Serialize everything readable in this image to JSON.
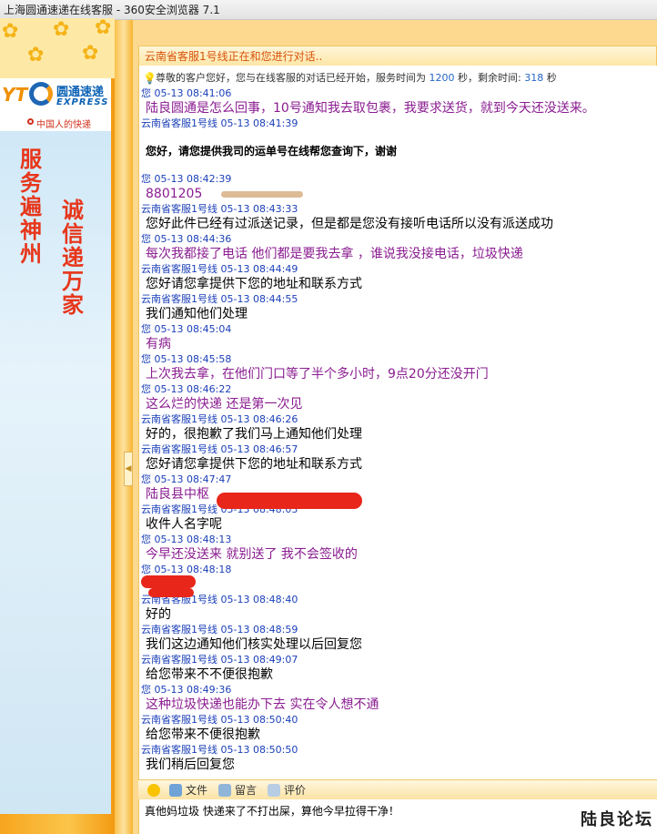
{
  "window_title": "上海圆通速递在线客服 - 360安全浏览器 7.1",
  "brand": {
    "logo_text": "YT",
    "name_cn": "圆通速递",
    "name_en": "EXPRESS",
    "slogan": "中国人的快递",
    "vertical_left": "服务遍神州",
    "vertical_right": "诚信递万家",
    "colors": {
      "orange": "#f7a51e",
      "blue": "#0b62b5",
      "red": "#e7361b"
    }
  },
  "chat_header": "云南省客服1号线正在和您进行对话..",
  "system_notice": {
    "prefix": "尊敬的客户您好，您与在线客服的对话已经开始，服务时间为",
    "service_seconds": "1200",
    "middle": "秒，剩余时间:",
    "remaining_seconds": "318",
    "suffix": "秒"
  },
  "messages": [
    {
      "role": "user",
      "sender": "您",
      "time": "05-13 08:41:06",
      "text": "陆良圆通是怎么回事，10号通知我去取包裹，我要求送货，就到今天还没送来。"
    },
    {
      "role": "agent",
      "sender": "云南省客服1号线",
      "time": "05-13 08:41:39",
      "text": "您好，请您提供我司的运单号在线帮您查询下，谢谢"
    },
    {
      "role": "user",
      "sender": "您",
      "time": "05-13 08:42:39",
      "text": "8801205"
    },
    {
      "role": "agent",
      "sender": "云南省客服1号线",
      "time": "05-13 08:43:33",
      "text": "您好此件已经有过派送记录，但是都是您没有接听电话所以没有派送成功"
    },
    {
      "role": "user",
      "sender": "您",
      "time": "05-13 08:44:36",
      "text": "每次我都接了电话 他们都是要我去拿 ，谁说我没接电话，垃圾快递"
    },
    {
      "role": "agent",
      "sender": "云南省客服1号线",
      "time": "05-13 08:44:49",
      "text": "您好请您拿提供下您的地址和联系方式"
    },
    {
      "role": "agent",
      "sender": "云南省客服1号线",
      "time": "05-13 08:44:55",
      "text": "我们通知他们处理"
    },
    {
      "role": "user",
      "sender": "您",
      "time": "05-13 08:45:04",
      "text": "有病"
    },
    {
      "role": "user",
      "sender": "您",
      "time": "05-13 08:45:58",
      "text": "上次我去拿，在他们门口等了半个多小时，9点20分还没开门"
    },
    {
      "role": "user",
      "sender": "您",
      "time": "05-13 08:46:22",
      "text": "这么烂的快递 还是第一次见"
    },
    {
      "role": "agent",
      "sender": "云南省客服1号线",
      "time": "05-13 08:46:26",
      "text": "好的，很抱歉了我们马上通知他们处理"
    },
    {
      "role": "agent",
      "sender": "云南省客服1号线",
      "time": "05-13 08:46:57",
      "text": "您好请您拿提供下您的地址和联系方式"
    },
    {
      "role": "user",
      "sender": "您",
      "time": "05-13 08:47:47",
      "text": "陆良县中枢"
    },
    {
      "role": "agent",
      "sender": "云南省客服1号线",
      "time": "05-13 08:48:03",
      "text": "收件人名字呢"
    },
    {
      "role": "user",
      "sender": "您",
      "time": "05-13 08:48:13",
      "text": "今早还没送来 就别送了 我不会签收的"
    },
    {
      "role": "user",
      "sender": "您",
      "time": "05-13 08:48:18",
      "text": ""
    },
    {
      "role": "agent",
      "sender": "云南省客服1号线",
      "time": "05-13 08:48:40",
      "text": "好的"
    },
    {
      "role": "agent",
      "sender": "云南省客服1号线",
      "time": "05-13 08:48:59",
      "text": "我们这边通知他们核实处理以后回复您"
    },
    {
      "role": "agent",
      "sender": "云南省客服1号线",
      "time": "05-13 08:49:07",
      "text": "给您带来不不便很抱歉"
    },
    {
      "role": "user",
      "sender": "您",
      "time": "05-13 08:49:36",
      "text": "这种垃圾快递也能办下去 实在令人想不通"
    },
    {
      "role": "agent",
      "sender": "云南省客服1号线",
      "time": "05-13 08:50:40",
      "text": "给您带来不便很抱歉"
    },
    {
      "role": "agent",
      "sender": "云南省客服1号线",
      "time": "05-13 08:50:50",
      "text": "我们稍后回复您"
    }
  ],
  "toolbar": {
    "emoji_icon": "smiley-icon",
    "file_label": "文件",
    "message_label": "留言",
    "rate_label": "评价"
  },
  "input": {
    "value": "真他妈垃圾 快递来了不打出屎，算他今早拉得干净！"
  },
  "watermark": "陆良论坛"
}
